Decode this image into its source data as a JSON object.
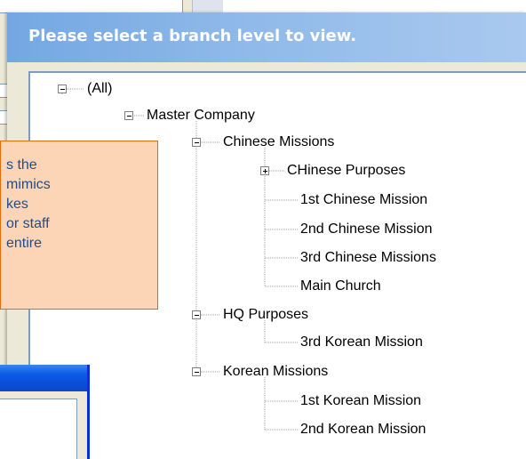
{
  "dialog": {
    "title": "Please select a branch level to view."
  },
  "tree": {
    "all": "(All)",
    "master": "Master Company",
    "chinese_missions": "Chinese Missions",
    "chinese_purposes": "CHinese Purposes",
    "chinese_1": "1st Chinese Mission",
    "chinese_2": "2nd Chinese Mission",
    "chinese_3": "3rd Chinese Missions",
    "main_church": "Main Church",
    "hq_purposes": "HQ Purposes",
    "korean_3": "3rd Korean Mission",
    "korean_missions": "Korean Missions",
    "korean_1": "1st Korean Mission",
    "korean_2": "2nd Korean Mission"
  },
  "callout": {
    "lines": [
      "s the",
      "mimics",
      "kes",
      "or staff",
      " entire"
    ]
  },
  "colors": {
    "header_gradient_start": "#74a7e2",
    "header_gradient_end": "#a9c9ef",
    "dialog_bg": "#ece9d8",
    "callout_bg": "#fbd5b5",
    "callout_border": "#e46c0a",
    "callout_text": "#1f4e8c",
    "xp_titlebar": "#0b5ce8"
  }
}
